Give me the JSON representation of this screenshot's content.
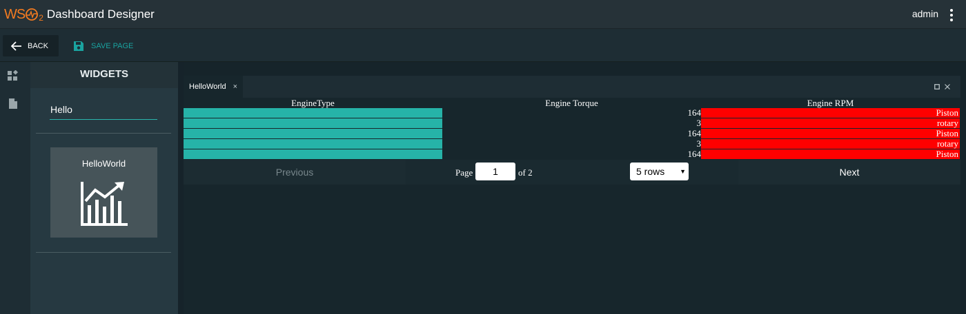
{
  "app": {
    "logo_text": "WSO2",
    "title": "Dashboard Designer",
    "user": "admin"
  },
  "toolbar": {
    "back_label": "BACK",
    "save_label": "SAVE PAGE"
  },
  "widgets_panel": {
    "heading": "WIDGETS",
    "search_value": "Hello",
    "items": [
      {
        "label": "HelloWorld",
        "icon": "chart-growth-icon"
      }
    ]
  },
  "canvas": {
    "tab": {
      "label": "HelloWorld",
      "close_glyph": "×"
    },
    "table": {
      "headers": [
        "EngineType",
        "Engine Torque",
        "Engine RPM"
      ],
      "rows": [
        {
          "torque": "164",
          "rpm": "Piston"
        },
        {
          "torque": "3",
          "rpm": "rotary"
        },
        {
          "torque": "164",
          "rpm": "Piston"
        },
        {
          "torque": "3",
          "rpm": "rotary"
        },
        {
          "torque": "164",
          "rpm": "Piston"
        }
      ]
    },
    "pager": {
      "previous_label": "Previous",
      "page_label": "Page",
      "page_value": "1",
      "of_label": "of 2",
      "rows_option": "5 rows",
      "next_label": "Next"
    }
  },
  "colors": {
    "accent": "#1aa3a0",
    "engine_type_fill": "#26b3a8",
    "rpm_fill": "#ff0000"
  }
}
